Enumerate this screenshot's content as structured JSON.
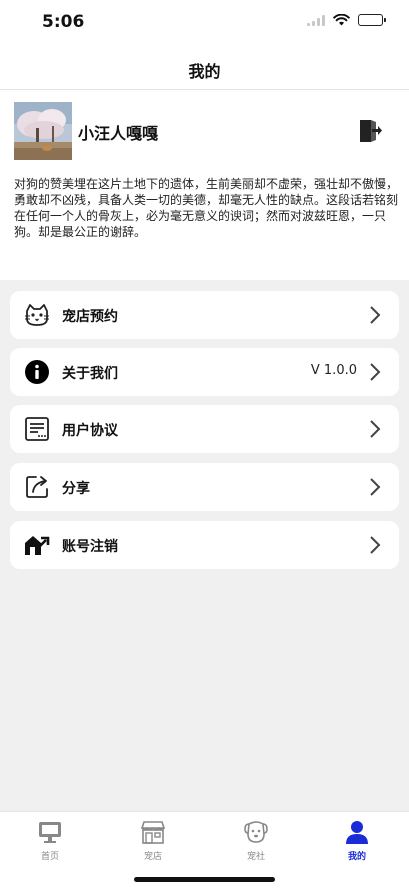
{
  "status_bar": {
    "time": "5:06"
  },
  "header": {
    "title": "我的"
  },
  "profile": {
    "username": "小汪人嘎嘎",
    "bio": "对狗的赞美埋在这片土地下的遗体，生前美丽却不虚荣，强壮却不傲慢，勇敢却不凶残，具备人类一切的美德，却毫无人性的缺点。这段话若铭刻在任何一个人的骨灰上，必为毫无意义的谀词；然而对波兹旺恩，一只狗。却是最公正的谢辞。"
  },
  "menu": {
    "items": [
      {
        "label": "宠店预约",
        "icon": "cat-icon"
      },
      {
        "label": "关于我们",
        "icon": "info-icon",
        "value": "V 1.0.0"
      },
      {
        "label": "用户协议",
        "icon": "document-icon"
      },
      {
        "label": "分享",
        "icon": "share-icon"
      },
      {
        "label": "账号注销",
        "icon": "house-exit-icon"
      }
    ]
  },
  "tabbar": {
    "tabs": [
      {
        "label": "首页",
        "icon": "monitor-icon"
      },
      {
        "label": "宠店",
        "icon": "store-icon"
      },
      {
        "label": "宠社",
        "icon": "dog-icon"
      },
      {
        "label": "我的",
        "icon": "person-icon",
        "active": true
      }
    ]
  },
  "colors": {
    "accent": "#1a2bd8",
    "background": "#f0f0f0",
    "inactive_tab": "#888888"
  }
}
